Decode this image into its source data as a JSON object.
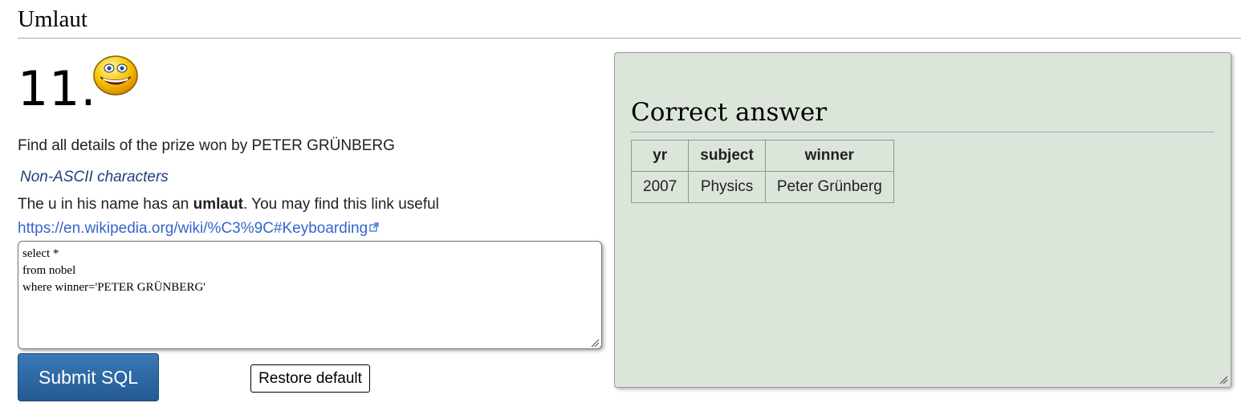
{
  "page": {
    "title": "Umlaut",
    "question_number": "11."
  },
  "question": {
    "text": "Find all details of the prize won by PETER GRÜNBERG",
    "hint_title": "Non-ASCII characters",
    "hint_prefix": "The u in his name has an ",
    "hint_bold": "umlaut",
    "hint_suffix": ". You may find this link useful",
    "link_text": "https://en.wikipedia.org/wiki/%C3%9C#Keyboarding"
  },
  "editor": {
    "sql": "select *\nfrom nobel\nwhere winner='PETER GRÜNBERG'"
  },
  "buttons": {
    "submit": "Submit SQL",
    "restore": "Restore default"
  },
  "answer": {
    "heading": "Correct answer",
    "columns": [
      "yr",
      "subject",
      "winner"
    ],
    "rows": [
      [
        "2007",
        "Physics",
        "Peter Grünberg"
      ]
    ]
  },
  "icons": {
    "smiley": "smiley-face-icon",
    "external_link": "external-link-icon",
    "resize": "resize-grip-icon"
  },
  "colors": {
    "link": "#3366cc",
    "submit_button": "#2b659f",
    "answer_panel_bg": "#dbe5da",
    "hint_title": "#1f3f7a"
  }
}
